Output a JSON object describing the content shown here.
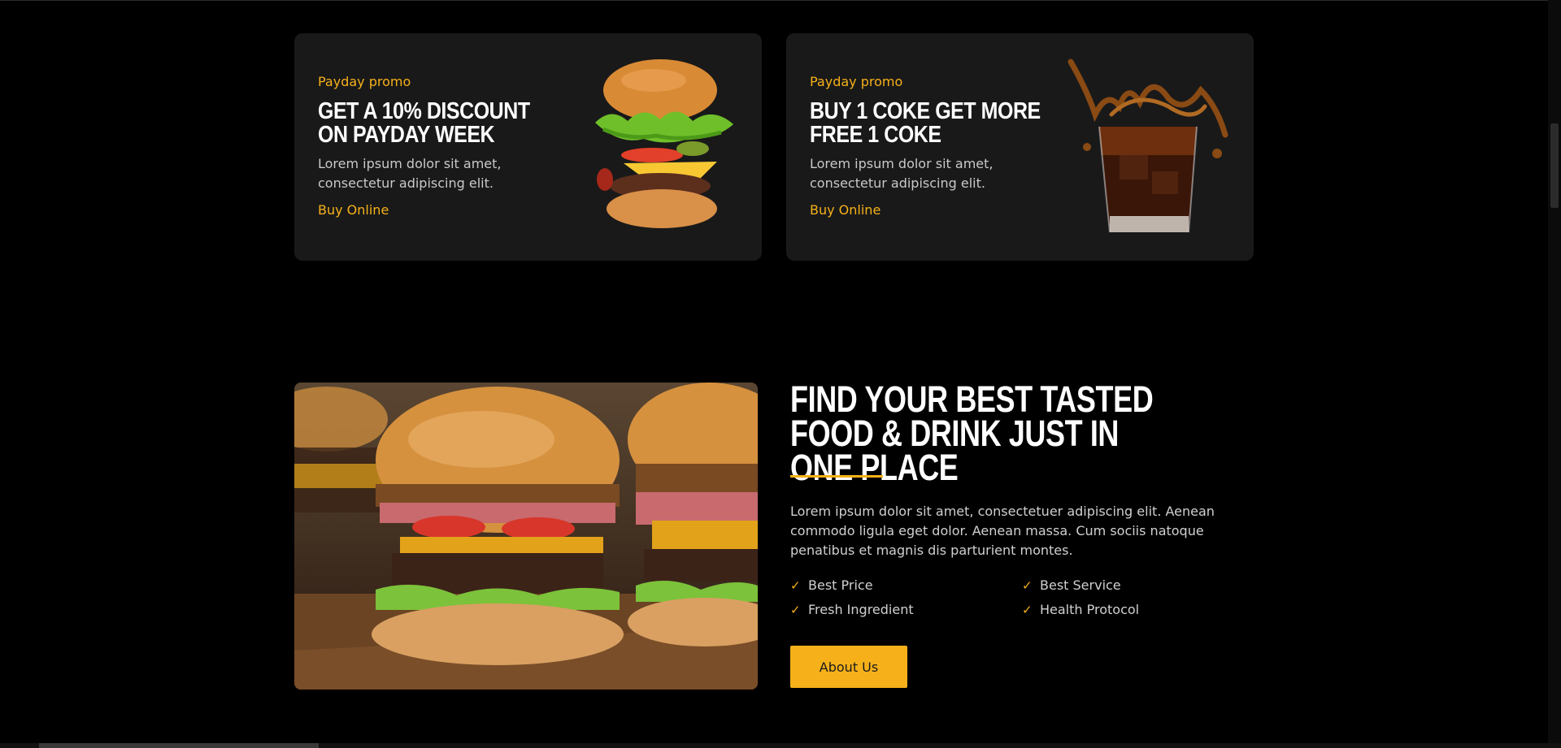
{
  "promos": [
    {
      "kicker": "Payday promo",
      "title": "GET A 10% DISCOUNT ON PAYDAY WEEK",
      "text": "Lorem ipsum dolor sit amet, consectetur adipiscing elit.",
      "link": "Buy Online"
    },
    {
      "kicker": "Payday promo",
      "title": "BUY 1 COKE GET MORE FREE 1 COKE",
      "text": "Lorem ipsum dolor sit amet, consectetur adipiscing elit.",
      "link": "Buy Online"
    }
  ],
  "about": {
    "title": "FIND YOUR BEST TASTED FOOD & DRINK JUST IN ONE PLACE",
    "text": "Lorem ipsum dolor sit amet, consectetuer adipiscing elit. Aenean commodo ligula eget dolor. Aenean massa. Cum sociis natoque penatibus et magnis dis parturient montes.",
    "features": [
      "Best Price",
      "Best Service",
      "Fresh Ingredient",
      "Health Protocol"
    ],
    "button_label": "About Us"
  },
  "colors": {
    "accent": "#f6b11a",
    "card_bg": "#191919",
    "page_bg": "#000000"
  },
  "icons": {
    "feature": "check-icon"
  }
}
